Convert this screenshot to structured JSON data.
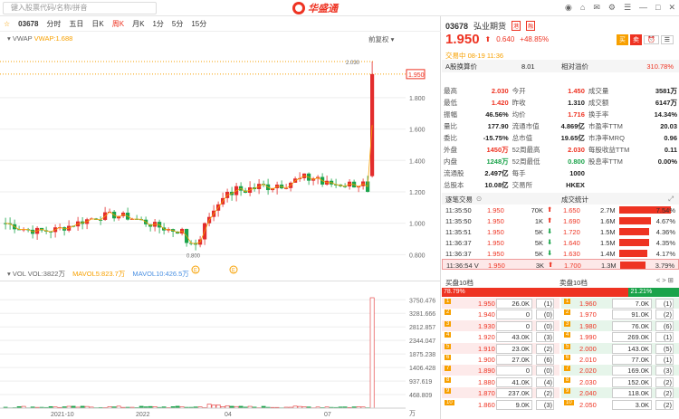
{
  "topbar": {
    "search_placeholder": "键入股票代码/名称/拼音",
    "brand": "华盛通"
  },
  "toolbar": {
    "code": "03678",
    "periods": [
      "分时",
      "五日",
      "日K",
      "周K",
      "月K",
      "1分",
      "5分",
      "15分"
    ],
    "active": "周K"
  },
  "main_chart": {
    "legend_name": "VWAP",
    "legend_value": "VWAP:1.688",
    "adjust": "前复权",
    "yticks": [
      "1.800",
      "1.600",
      "1.400",
      "1.200",
      "1.000",
      "0.800"
    ],
    "price_tag": "1.950",
    "max_label": "2.030",
    "min_label": "0.800",
    "markers": [
      "E",
      "E"
    ]
  },
  "vol_chart": {
    "legend": "VOL",
    "vol": "VOL:3822万",
    "ma5": "MAVOL5:823.7万",
    "ma10": "MAVOL10:426.5万",
    "yticks": [
      "3750.476",
      "3281.666",
      "2812.857",
      "2344.047",
      "1875.238",
      "1406.428",
      "937.619",
      "468.809"
    ],
    "unit": "万",
    "xticks": [
      "2021-10",
      "2022",
      "04",
      "07"
    ]
  },
  "quote": {
    "code": "03678",
    "name": "弘业期货",
    "price": "1.950",
    "change": "0.640",
    "pct": "+48.85%",
    "status": "交易中 08-19 11:36",
    "a_share_label": "A股换算价",
    "a_share_val": "8.01",
    "premium_label": "相对溢价",
    "premium_val": "310.78%"
  },
  "stats": [
    [
      "最高",
      "2.030",
      "今开",
      "1.450",
      "成交量",
      "3581万"
    ],
    [
      "最低",
      "1.420",
      "昨收",
      "1.310",
      "成交额",
      "6147万"
    ],
    [
      "振幅",
      "46.56%",
      "均价",
      "1.716",
      "换手率",
      "14.34%"
    ],
    [
      "量比",
      "177.90",
      "流通市值",
      "4.869亿",
      "市盈率TTM",
      "20.03"
    ],
    [
      "委比",
      "-15.75%",
      "总市值",
      "19.65亿",
      "市净率MRQ",
      "0.96"
    ],
    [
      "外盘",
      "1450万",
      "52周最高",
      "2.030",
      "每股收益TTM",
      "0.11"
    ],
    [
      "内盘",
      "1248万",
      "52周最低",
      "0.800",
      "股息率TTM",
      "0.00%"
    ],
    [
      "流通股",
      "2.497亿",
      "每手",
      "1000",
      "",
      ""
    ],
    [
      "总股本",
      "10.08亿",
      "交易所",
      "HKEX",
      "",
      ""
    ]
  ],
  "trades": {
    "tab1": "逐笔交易",
    "tab2": "成交统计",
    "rows": [
      [
        "11:35:50",
        "1.950",
        "70K",
        "up"
      ],
      [
        "11:35:50",
        "1.950",
        "1K",
        "up"
      ],
      [
        "11:35:51",
        "1.950",
        "5K",
        "down"
      ],
      [
        "11:36:37",
        "1.950",
        "5K",
        "down"
      ],
      [
        "11:36:37",
        "1.950",
        "5K",
        "down"
      ],
      [
        "11:36:54 V",
        "1.950",
        "3K",
        "up"
      ]
    ],
    "stats": [
      [
        "1.650",
        "2.7M",
        "7.54%"
      ],
      [
        "1.690",
        "1.6M",
        "4.67%"
      ],
      [
        "1.720",
        "1.5M",
        "4.36%"
      ],
      [
        "1.640",
        "1.5M",
        "4.35%"
      ],
      [
        "1.630",
        "1.4M",
        "4.17%"
      ],
      [
        "1.700",
        "1.3M",
        "3.79%"
      ]
    ]
  },
  "orderbook": {
    "bid_title": "买盘10档",
    "ask_title": "卖盘10档",
    "bid_pct": "78.79%",
    "ask_pct": "21.21%",
    "bids": [
      [
        "1",
        "1.950",
        "26.0K",
        "(1)"
      ],
      [
        "2",
        "1.940",
        "0",
        "(0)"
      ],
      [
        "3",
        "1.930",
        "0",
        "(0)"
      ],
      [
        "4",
        "1.920",
        "43.0K",
        "(3)"
      ],
      [
        "5",
        "1.910",
        "23.0K",
        "(2)"
      ],
      [
        "6",
        "1.900",
        "27.0K",
        "(6)"
      ],
      [
        "7",
        "1.890",
        "0",
        "(0)"
      ],
      [
        "8",
        "1.880",
        "41.0K",
        "(4)"
      ],
      [
        "9",
        "1.870",
        "237.0K",
        "(2)"
      ],
      [
        "10",
        "1.860",
        "9.0K",
        "(3)"
      ]
    ],
    "asks": [
      [
        "1",
        "1.960",
        "7.0K",
        "(1)"
      ],
      [
        "2",
        "1.970",
        "91.0K",
        "(2)"
      ],
      [
        "3",
        "1.980",
        "76.0K",
        "(6)"
      ],
      [
        "4",
        "1.990",
        "269.0K",
        "(1)"
      ],
      [
        "5",
        "2.000",
        "143.0K",
        "(5)"
      ],
      [
        "6",
        "2.010",
        "77.0K",
        "(1)"
      ],
      [
        "7",
        "2.020",
        "169.0K",
        "(3)"
      ],
      [
        "8",
        "2.030",
        "152.0K",
        "(2)"
      ],
      [
        "9",
        "2.040",
        "118.0K",
        "(2)"
      ],
      [
        "10",
        "2.050",
        "3.0K",
        "(2)"
      ]
    ]
  },
  "colors": {
    "up": "#e32d2d",
    "down": "#1aa34a",
    "accent": "#f7a000"
  }
}
